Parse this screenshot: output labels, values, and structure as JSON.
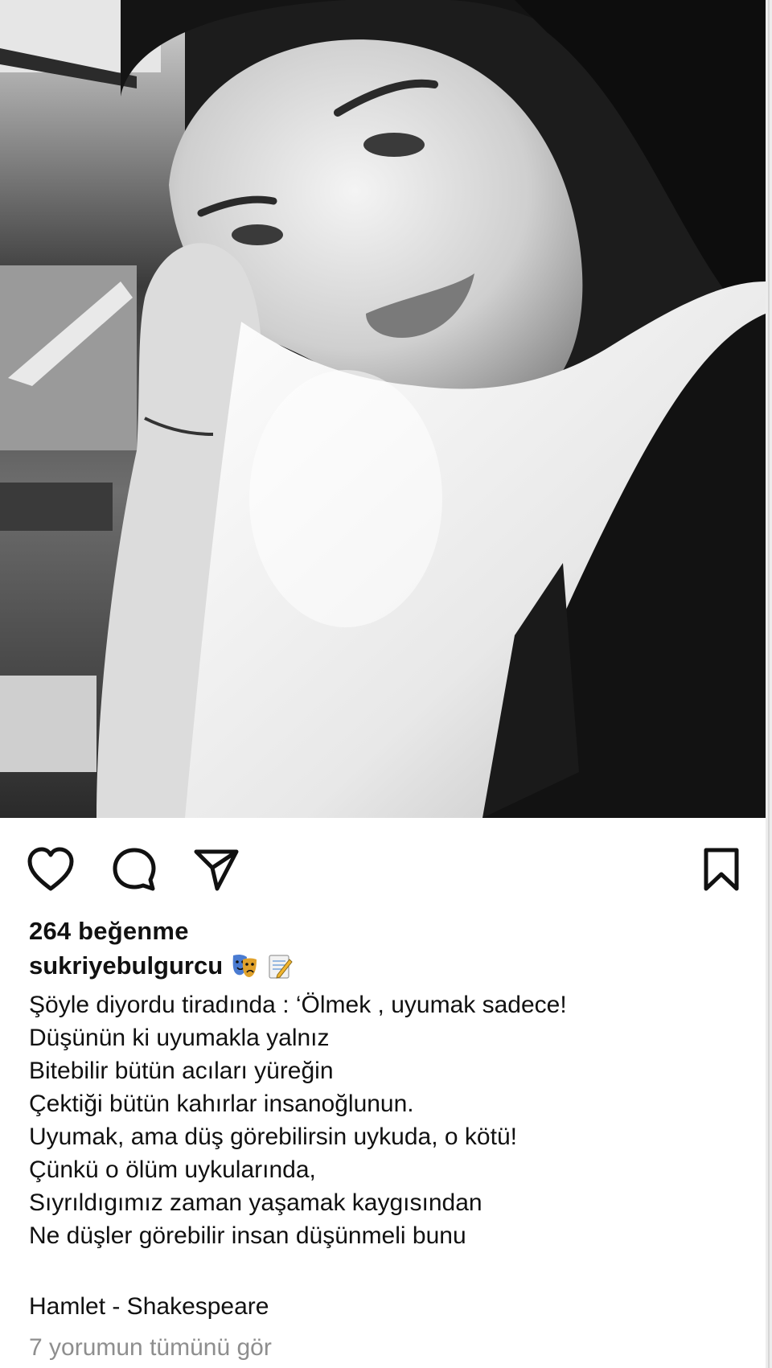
{
  "post": {
    "photo_icon": "portrait-photo-bw",
    "accent_color": "#111111"
  },
  "actions": {
    "like_icon": "heart-icon",
    "comment_icon": "comment-icon",
    "share_icon": "send-icon",
    "save_icon": "bookmark-icon"
  },
  "likes": {
    "text": "264 beğenme"
  },
  "caption": {
    "username": "sukriyebulgurcu",
    "emojis": [
      "theater-masks-emoji",
      "memo-emoji"
    ],
    "lines": [
      "Şöyle diyordu tiradında : ‘Ölmek , uyumak sadece!",
      "Düşünün ki uyumakla yalnız",
      "Bitebilir bütün acıları yüreğin",
      "Çektiği bütün kahırlar insanoğlunun.",
      "Uyumak, ama düş görebilirsin uykuda, o kötü!",
      "Çünkü o ölüm uykularında,",
      "Sıyrıldıgımız zaman yaşamak kaygısından",
      "Ne düşler görebilir insan düşünmeli bunu"
    ],
    "signature": "Hamlet - Shakespeare"
  },
  "comments": {
    "view_all": "7 yorumun tümünü gör",
    "muted_color": "#8e8e8e"
  }
}
